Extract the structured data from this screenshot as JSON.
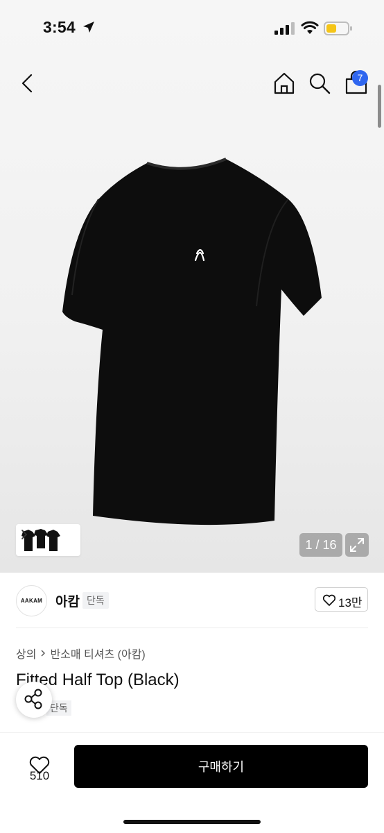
{
  "status_bar": {
    "time": "3:54"
  },
  "nav": {
    "cart_badge": "7"
  },
  "gallery": {
    "counter": "1 / 16"
  },
  "brand": {
    "logo_text": "AAKAM",
    "name": "아캄",
    "tag": "단독",
    "likes": "13만"
  },
  "product": {
    "breadcrumb": [
      "상의",
      "반소매 티셔츠 (아캄)"
    ],
    "title": "Fitted Half Top (Black)",
    "tag": "단독"
  },
  "bottom_bar": {
    "wish_count": "510",
    "buy_label": "구매하기"
  },
  "colors": {
    "badge": "#2f66ef",
    "buy_button": "#000000",
    "battery": "#f5c518"
  }
}
